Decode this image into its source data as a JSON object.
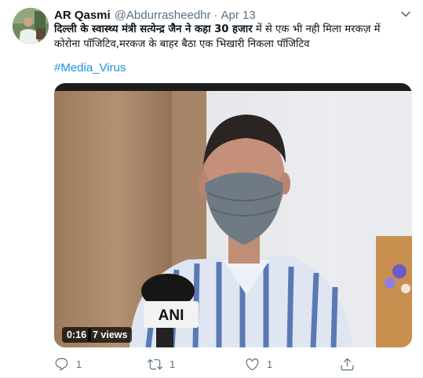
{
  "tweet": {
    "author": {
      "display_name": "AR Qasmi",
      "handle": "@Abdurrasheedhr"
    },
    "separator": "·",
    "date": "Apr 13",
    "text": {
      "line1_bold": "दिल्ली के स्वास्थ्य मंत्री सत्येन्द्र जैन ने कहा 30 हजार",
      "line1_rest": " में से एक भी नही मिला मरकज़ में",
      "line2": "कोरोना पॉजिटिव,मरकज के बाहर बैठा एक भिखारी निकला पॉजिटिव"
    },
    "hashtag": "#Media_Virus",
    "media": {
      "duration": "0:16",
      "views": "7 views",
      "mic_logo": "ANI"
    },
    "actions": {
      "reply_count": "1",
      "retweet_count": "1",
      "like_count": "1"
    }
  },
  "icons": {
    "caret": "chevron-down-icon",
    "reply": "reply-icon",
    "retweet": "retweet-icon",
    "like": "heart-icon",
    "share": "share-icon"
  },
  "colors": {
    "text": "#0f1419",
    "secondary": "#5b7083",
    "link": "#1b95e0"
  }
}
